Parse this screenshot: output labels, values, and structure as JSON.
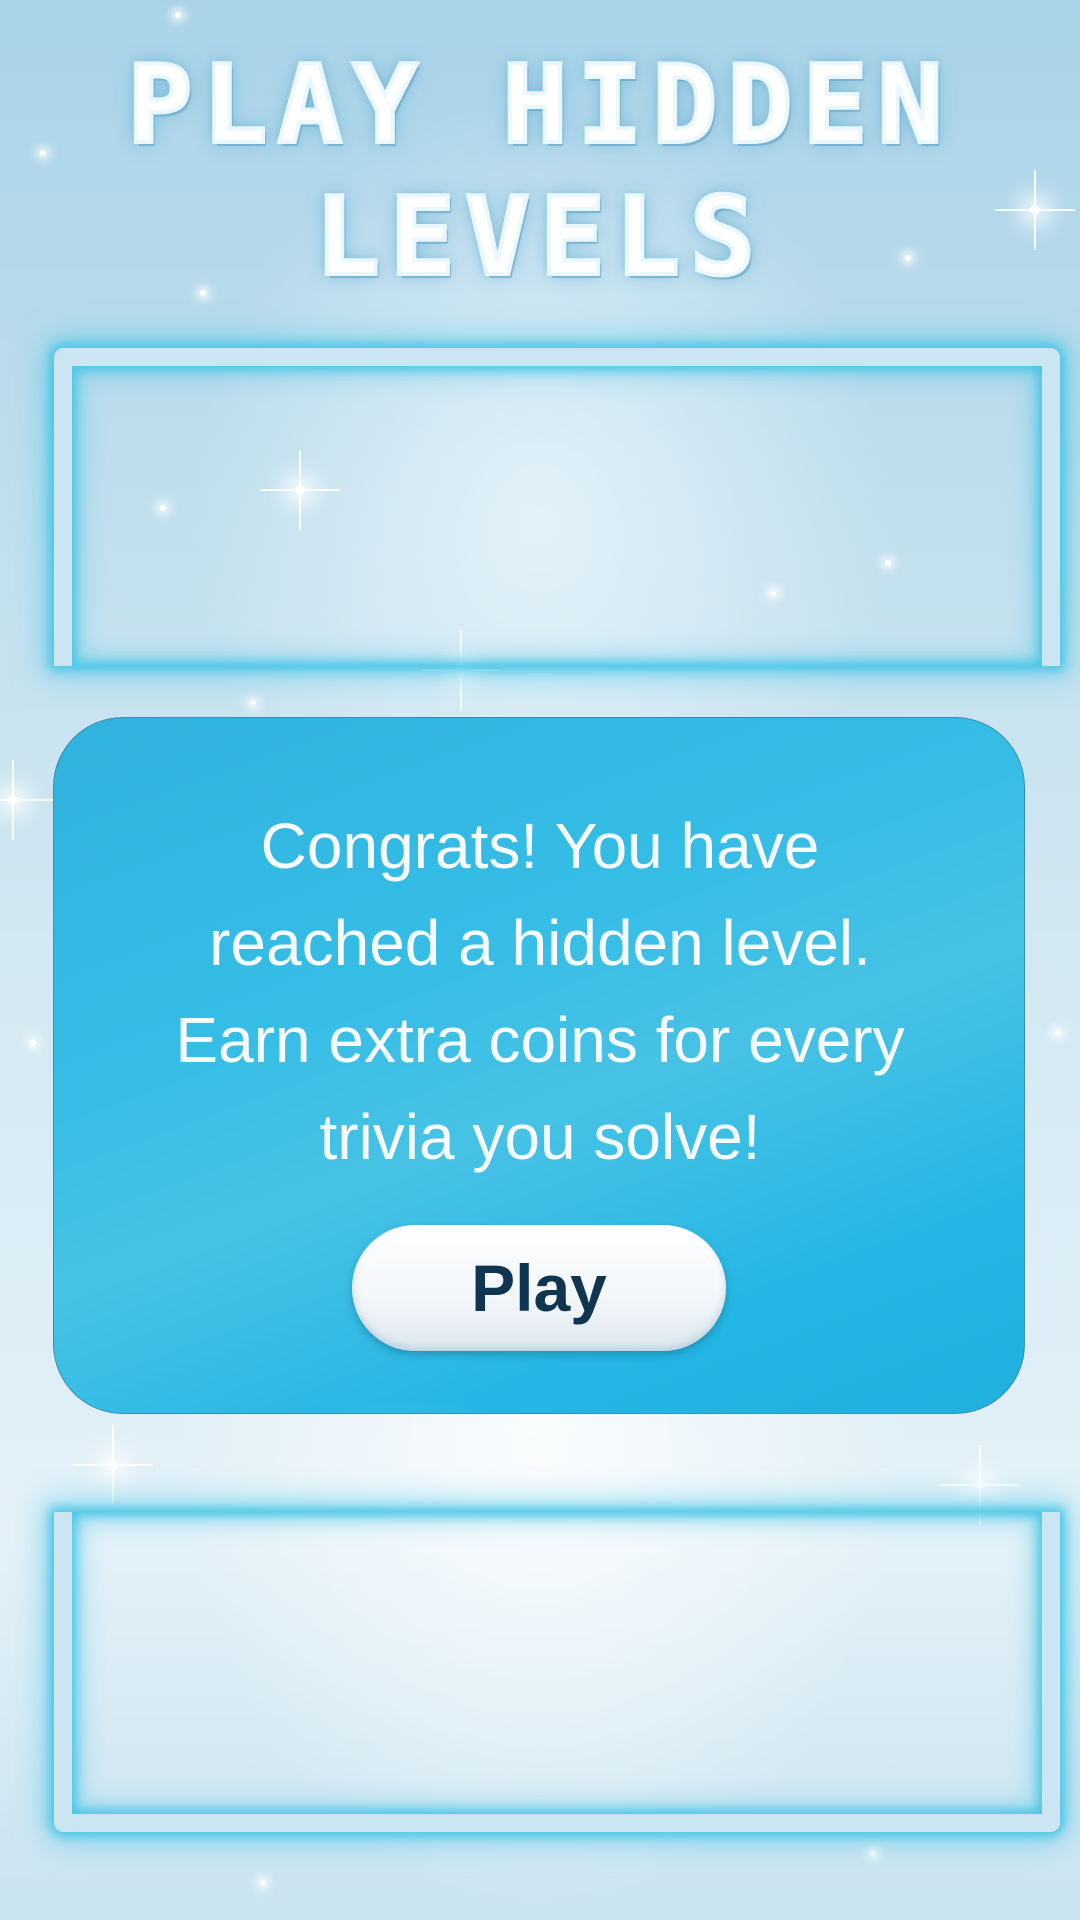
{
  "title": "PLAY HIDDEN LEVELS",
  "card": {
    "message": "Congrats! You have reached a hidden level. Earn extra coins for every trivia you solve!",
    "play_button_label": "Play"
  },
  "colors": {
    "background": "#c6e2f0",
    "frame_glow": "#40c4e6",
    "card": "#2fb5e1",
    "button": "#f4f7fa",
    "button_text": "#0f3550"
  }
}
